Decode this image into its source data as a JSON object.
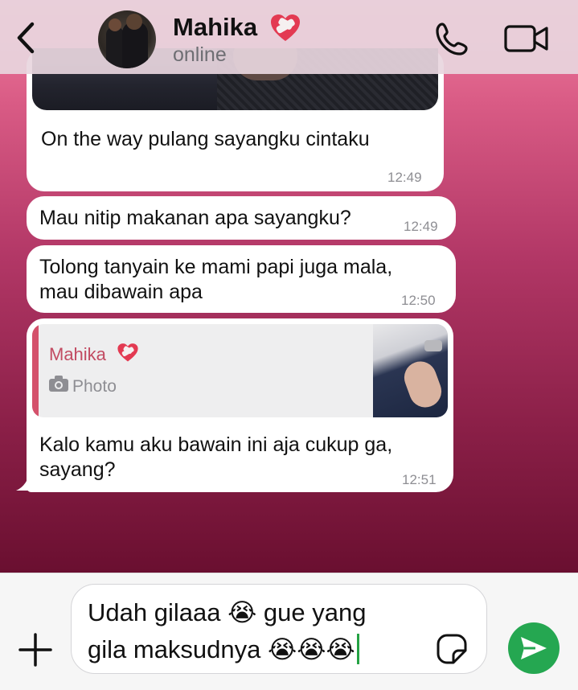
{
  "header": {
    "contact_name": "Mahika",
    "contact_status": "online",
    "name_emoji": "heart-with-bandage-icon"
  },
  "messages": [
    {
      "text": "On the way pulang sayangku cintaku",
      "time": "12:49",
      "has_photo": true
    },
    {
      "text": "Mau nitip makanan apa sayangku?",
      "time": "12:49"
    },
    {
      "text": "Tolong tanyain ke mami papi juga mala, mau dibawain apa",
      "time": "12:50"
    },
    {
      "quoted": {
        "name": "Mahika",
        "label": "Photo"
      },
      "text": "Kalo kamu aku bawain ini aja cukup ga, sayang?",
      "time": "12:51"
    }
  ],
  "composer": {
    "line1": "Udah gilaaa 😭 gue yang",
    "line2": "gila maksudnya 😭😭😭"
  },
  "colors": {
    "accent_green": "#25a751",
    "quote_bar": "#d4516b",
    "quote_name": "#c24b62"
  }
}
